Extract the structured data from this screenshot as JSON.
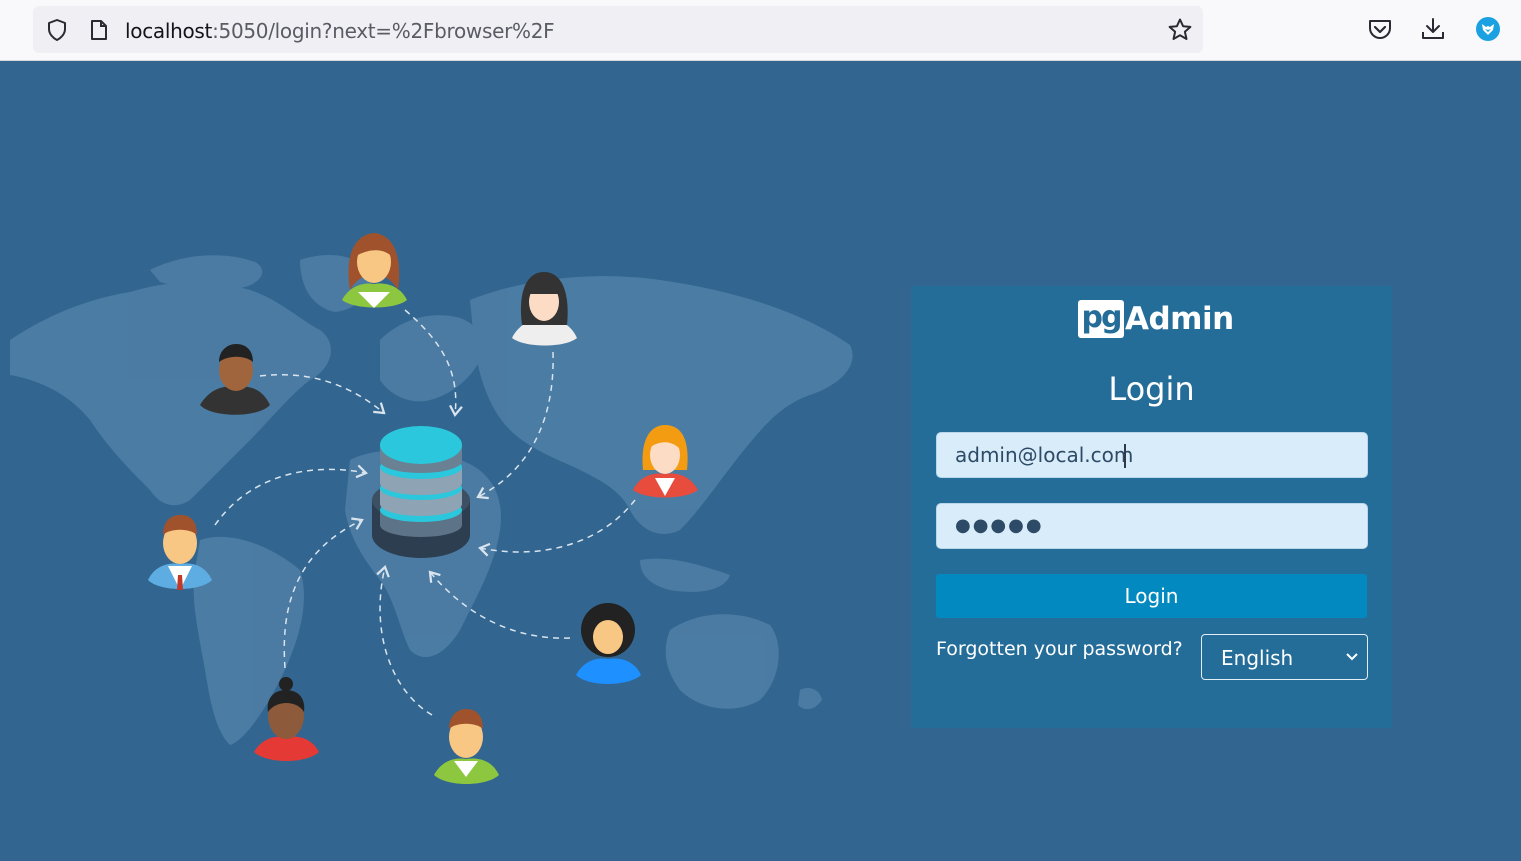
{
  "browser": {
    "url_host": "localhost",
    "url_rest": ":5050/login?next=%2Fbrowser%2F",
    "icons": [
      "shield-icon",
      "page-icon",
      "star-icon",
      "pocket-icon",
      "download-icon",
      "extension-fox-icon"
    ]
  },
  "login": {
    "logo_pg": "pg",
    "logo_admin": "Admin",
    "title": "Login",
    "email_value": "admin@local.com",
    "password_masked": "●●●●●",
    "login_button": "Login",
    "forgot_link": "Forgotten your password?",
    "language_selected": "English"
  },
  "colors": {
    "page_bg": "#326690",
    "panel_bg": "#256d99",
    "field_bg": "#d8edf9",
    "button_bg": "#028ac0",
    "database_cyan": "#2bc7dc"
  }
}
